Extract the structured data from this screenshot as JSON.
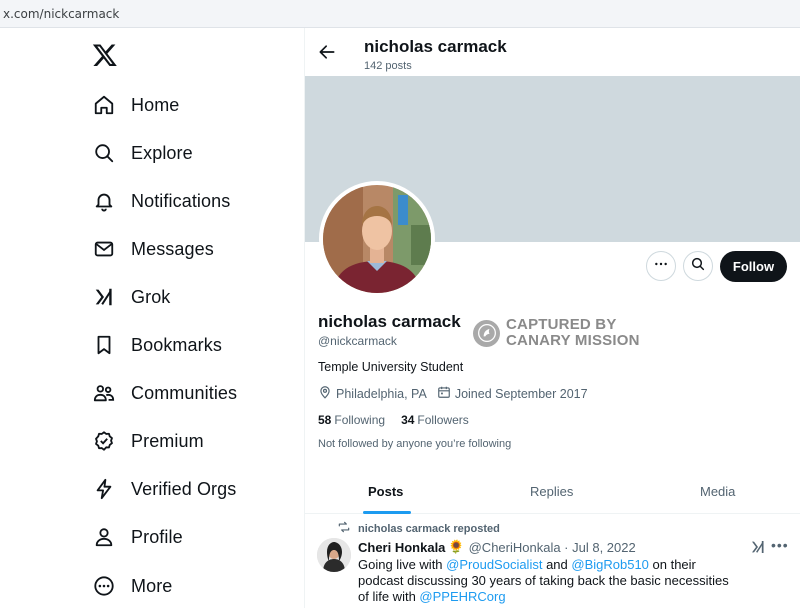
{
  "browser": {
    "url": "x.com/nickcarmack"
  },
  "sidebar": {
    "logo_icon": "x-logo-icon",
    "items": [
      {
        "label": "Home",
        "icon": "home-icon"
      },
      {
        "label": "Explore",
        "icon": "search-icon"
      },
      {
        "label": "Notifications",
        "icon": "bell-icon"
      },
      {
        "label": "Messages",
        "icon": "envelope-icon"
      },
      {
        "label": "Grok",
        "icon": "grok-icon"
      },
      {
        "label": "Bookmarks",
        "icon": "bookmark-icon"
      },
      {
        "label": "Communities",
        "icon": "people-icon"
      },
      {
        "label": "Premium",
        "icon": "verified-badge-icon"
      },
      {
        "label": "Verified Orgs",
        "icon": "lightning-icon"
      },
      {
        "label": "Profile",
        "icon": "person-icon"
      },
      {
        "label": "More",
        "icon": "more-circle-icon"
      }
    ]
  },
  "header": {
    "name": "nicholas carmack",
    "posts": "142 posts"
  },
  "profile": {
    "name": "nicholas carmack",
    "handle": "@nickcarmack",
    "bio": "Temple University Student",
    "location": "Philadelphia, PA",
    "joined": "Joined September 2017",
    "following_count": "58",
    "following_label": "Following",
    "followers_count": "34",
    "followers_label": "Followers",
    "not_followed": "Not followed by anyone you’re following",
    "follow_label": "Follow"
  },
  "watermark": {
    "line1": "CAPTURED BY",
    "line2": "CANARY MISSION"
  },
  "tabs": [
    "Posts",
    "Replies",
    "Media"
  ],
  "tweet": {
    "repost_label": "nicholas carmack reposted",
    "author": "Cheri Honkala",
    "emoji": "🌻",
    "handle_date": "@CheriHonkala · Jul 8, 2022",
    "body_1": "Going live with ",
    "mention_1": "@ProudSocialist",
    "body_2": " and ",
    "mention_2": "@BigRob510",
    "body_3": " on their podcast discussing 30 years of taking back the basic necessities of life with ",
    "mention_3": "@PPEHRCorg"
  },
  "colors": {
    "accent": "#1d9bf0",
    "follow_bg": "#0f1419",
    "banner": "#cfd9de"
  }
}
